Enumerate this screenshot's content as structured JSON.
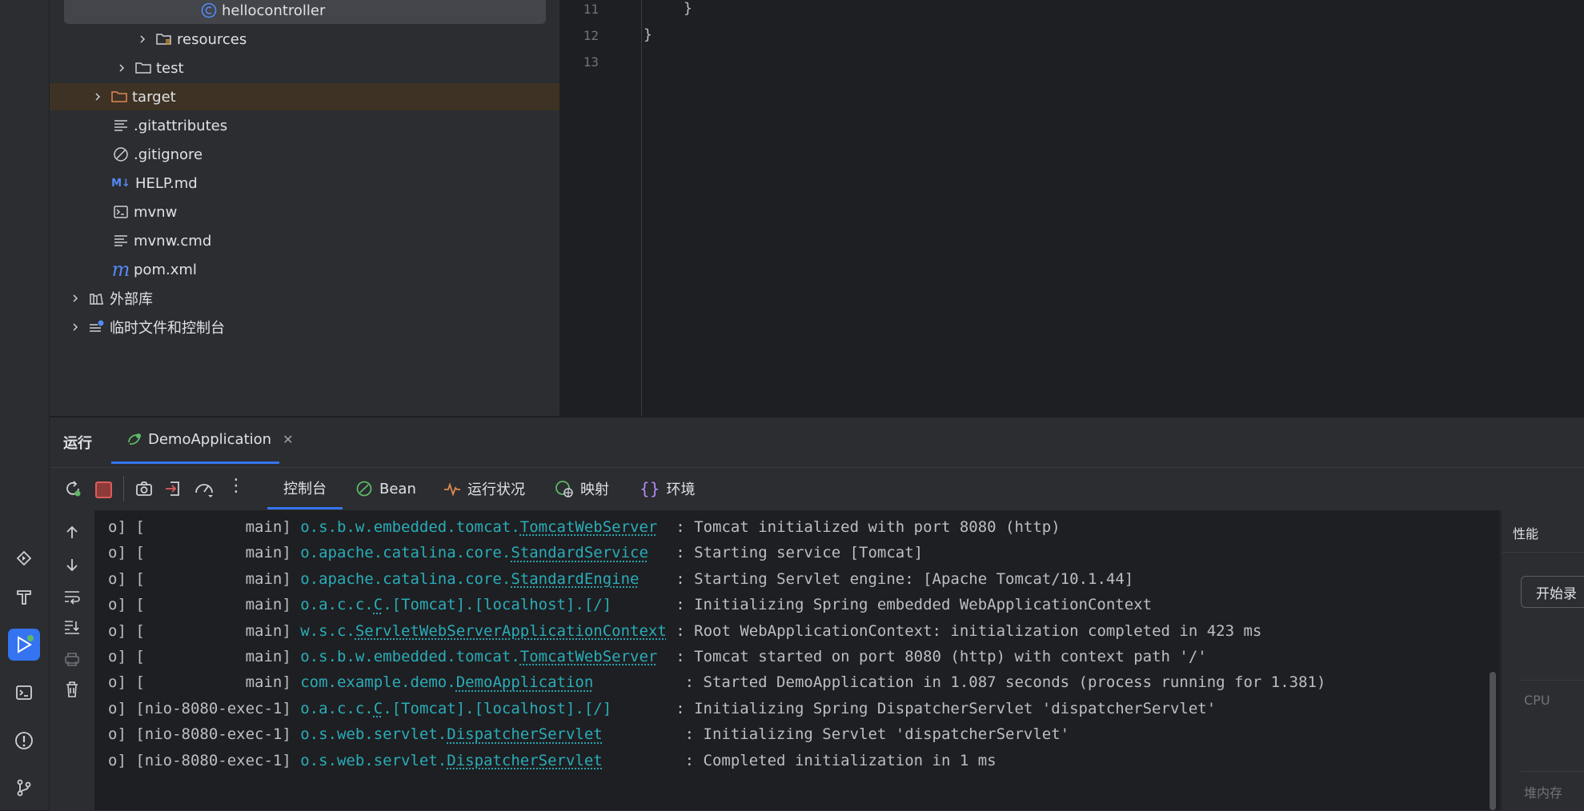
{
  "tree": {
    "items": [
      {
        "label": "hellocontroller",
        "icon": "class-icon"
      },
      {
        "label": "resources",
        "icon": "resources-folder-icon"
      },
      {
        "label": "test",
        "icon": "folder-icon"
      },
      {
        "label": "target",
        "icon": "folder-icon"
      },
      {
        "label": ".gitattributes",
        "icon": "text-file-icon"
      },
      {
        "label": ".gitignore",
        "icon": "ignore-file-icon"
      },
      {
        "label": "HELP.md",
        "icon": "markdown-icon",
        "badge": "M↓"
      },
      {
        "label": "mvnw",
        "icon": "shell-script-icon"
      },
      {
        "label": "mvnw.cmd",
        "icon": "text-file-icon"
      },
      {
        "label": "pom.xml",
        "icon": "maven-icon",
        "badge": "m"
      },
      {
        "label": "外部库",
        "icon": "library-icon"
      },
      {
        "label": "临时文件和控制台",
        "icon": "scratches-icon"
      }
    ]
  },
  "editor": {
    "line_numbers": [
      "11",
      "12",
      "13"
    ],
    "lines": [
      "}",
      "}",
      ""
    ]
  },
  "run": {
    "title": "运行",
    "config_tab": "DemoApplication",
    "tabs": [
      {
        "label": "控制台",
        "icon": ""
      },
      {
        "label": "Bean",
        "icon": "bean-icon"
      },
      {
        "label": "运行状况",
        "icon": "health-icon"
      },
      {
        "label": "映射",
        "icon": "mappings-icon"
      },
      {
        "label": "环境",
        "icon": "environment-icon"
      }
    ],
    "console": [
      {
        "prefix": "o] [           main] ",
        "pkg": "o.s.b.w.embedded.tomcat.",
        "cls": "TomcatWebServer",
        "pad": "  ",
        "msg": ": Tomcat initialized with port 8080 (http)"
      },
      {
        "prefix": "o] [           main] ",
        "pkg": "o.apache.catalina.core.",
        "cls": "StandardService",
        "pad": "   ",
        "msg": ": Starting service [Tomcat]"
      },
      {
        "prefix": "o] [           main] ",
        "pkg": "o.apache.catalina.core.",
        "cls": "StandardEngine",
        "pad": "    ",
        "msg": ": Starting Servlet engine: [Apache Tomcat/10.1.44]"
      },
      {
        "prefix": "o] [           main] ",
        "pkg": "o.a.c.c.",
        "cls": "C",
        "pad": "",
        "rest": ".[Tomcat].[localhost].[/]       ",
        "msg": ": Initializing Spring embedded WebApplicationContext"
      },
      {
        "prefix": "o] [           main] ",
        "pkg": "w.s.c.",
        "cls": "ServletWebServerApplicationContext",
        "pad": " ",
        "msg": ": Root WebApplicationContext: initialization completed in 423 ms"
      },
      {
        "prefix": "o] [           main] ",
        "pkg": "o.s.b.w.embedded.tomcat.",
        "cls": "TomcatWebServer",
        "pad": "  ",
        "msg": ": Tomcat started on port 8080 (http) with context path '/'"
      },
      {
        "prefix": "o] [           main] ",
        "pkg": "com.example.demo.",
        "cls": "DemoApplication",
        "pad": "          ",
        "msg": ": Started DemoApplication in 1.087 seconds (process running for 1.381)"
      },
      {
        "prefix": "o] [nio-8080-exec-1] ",
        "pkg": "o.a.c.c.",
        "cls": "C",
        "pad": "",
        "rest": ".[Tomcat].[localhost].[/]       ",
        "msg": ": Initializing Spring DispatcherServlet 'dispatcherServlet'"
      },
      {
        "prefix": "o] [nio-8080-exec-1] ",
        "pkg": "o.s.web.servlet.",
        "cls": "DispatcherServlet",
        "pad": "         ",
        "msg": ": Initializing Servlet 'dispatcherServlet'"
      },
      {
        "prefix": "o] [nio-8080-exec-1] ",
        "pkg": "o.s.web.servlet.",
        "cls": "DispatcherServlet",
        "pad": "         ",
        "msg": ": Completed initialization in 1 ms"
      }
    ]
  },
  "perf": {
    "title": "性能",
    "button": "开始录",
    "cpu_label": "CPU",
    "heap_label": "堆内存"
  },
  "colors": {
    "accent": "#3574f0",
    "link": "#2aacb8",
    "stop": "#db5c5c",
    "target_bg": "#3d3223"
  }
}
